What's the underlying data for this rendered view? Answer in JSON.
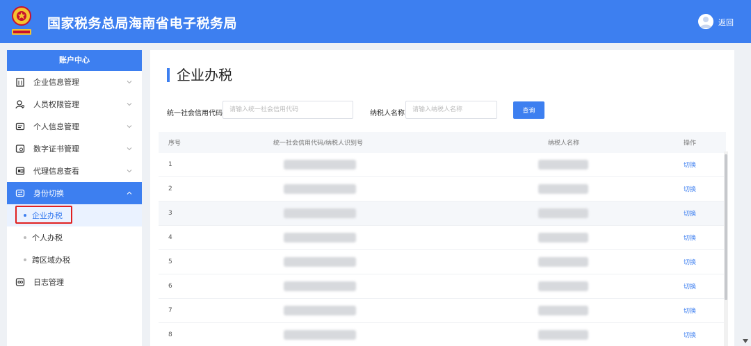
{
  "header": {
    "title": "国家税务总局海南省电子税务局",
    "back_label": "返回",
    "emblem_icon": "tax-emblem-icon",
    "accent_color": "#3d7ff0"
  },
  "sidebar": {
    "heading": "账户中心",
    "items": [
      {
        "label": "企业信息管理",
        "icon": "building-icon"
      },
      {
        "label": "人员权限管理",
        "icon": "user-permission-icon"
      },
      {
        "label": "个人信息管理",
        "icon": "id-card-icon"
      },
      {
        "label": "数字证书管理",
        "icon": "certificate-icon"
      },
      {
        "label": "代理信息查看",
        "icon": "agent-icon"
      },
      {
        "label": "身份切换",
        "icon": "switch-identity-icon"
      }
    ],
    "sub_items": [
      {
        "label": "企业办税"
      },
      {
        "label": "个人办税"
      },
      {
        "label": "跨区域办税"
      }
    ],
    "log_item": {
      "label": "日志管理",
      "icon": "log-icon"
    }
  },
  "main": {
    "title": "企业办税",
    "filters": {
      "code_label": "统一社会信用代码",
      "code_placeholder": "请输入统一社会信用代码",
      "name_label": "纳税人名称",
      "name_placeholder": "请输入纳税人名称",
      "query_label": "查询"
    },
    "table": {
      "headers": [
        "序号",
        "统一社会信用代码/纳税人识别号",
        "纳税人名称",
        "操作"
      ],
      "rows": [
        {
          "no": "1",
          "action": "切换"
        },
        {
          "no": "2",
          "action": "切换"
        },
        {
          "no": "3",
          "action": "切换"
        },
        {
          "no": "4",
          "action": "切换"
        },
        {
          "no": "5",
          "action": "切换"
        },
        {
          "no": "6",
          "action": "切换"
        },
        {
          "no": "7",
          "action": "切换"
        },
        {
          "no": "8",
          "action": "切换"
        }
      ]
    }
  }
}
